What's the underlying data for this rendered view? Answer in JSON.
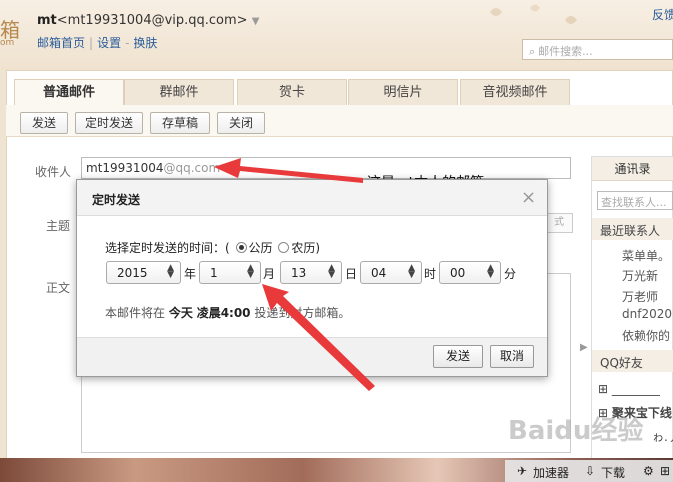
{
  "header": {
    "logo_fragment": "箱",
    "logo_suffix": "om",
    "account_name": "mt",
    "account_email": "<mt19931004@vip.qq.com>",
    "links": [
      "邮箱首页",
      "设置",
      "换肤"
    ],
    "top_right": "反馈",
    "search_placeholder": "邮件搜索..."
  },
  "tabs": [
    "普通邮件",
    "群邮件",
    "贺卡",
    "明信片",
    "音视频邮件"
  ],
  "toolbar": [
    "发送",
    "定时发送",
    "存草稿",
    "关闭"
  ],
  "compose": {
    "to_label": "收件人",
    "subject_label": "主题",
    "body_label": "正文",
    "to_user": "mt19931004",
    "to_host": "@qq.com",
    "subject_tail": "式",
    "annotation": "这是mt本人的邮箱"
  },
  "sidebar": {
    "title": "通讯录",
    "search_placeholder": "查找联系人...",
    "recent_title": "最近联系人",
    "contacts": [
      "菜单单。",
      "万光新",
      "万老师",
      "dnf2020",
      "依赖你的"
    ],
    "qq_title": "QQ好友",
    "qq_items": [
      "________",
      "聚来宝下线",
      "ゎ.丿"
    ]
  },
  "dialog": {
    "title": "定时发送",
    "prompt": "选择定时发送的时间：(",
    "calendar_solar": "公历",
    "calendar_lunar": "农历)",
    "year": "2015",
    "year_unit": "年",
    "month": "1",
    "month_unit": "月",
    "day": "13",
    "day_unit": "日",
    "hour": "04",
    "hour_unit": "时",
    "minute": "00",
    "minute_unit": "分",
    "note_prefix": "本邮件将在",
    "note_day": "今天",
    "note_time": "凌晨4:00",
    "note_suffix": "投递到对方邮箱。",
    "send_btn": "发送",
    "cancel_btn": "取消"
  },
  "bottom": {
    "watermark": "Baidu经验",
    "accelerator": "加速器",
    "download": "下载"
  },
  "colors": {
    "annotation_arrow": "#e8393b",
    "link": "#2a5c9a"
  }
}
